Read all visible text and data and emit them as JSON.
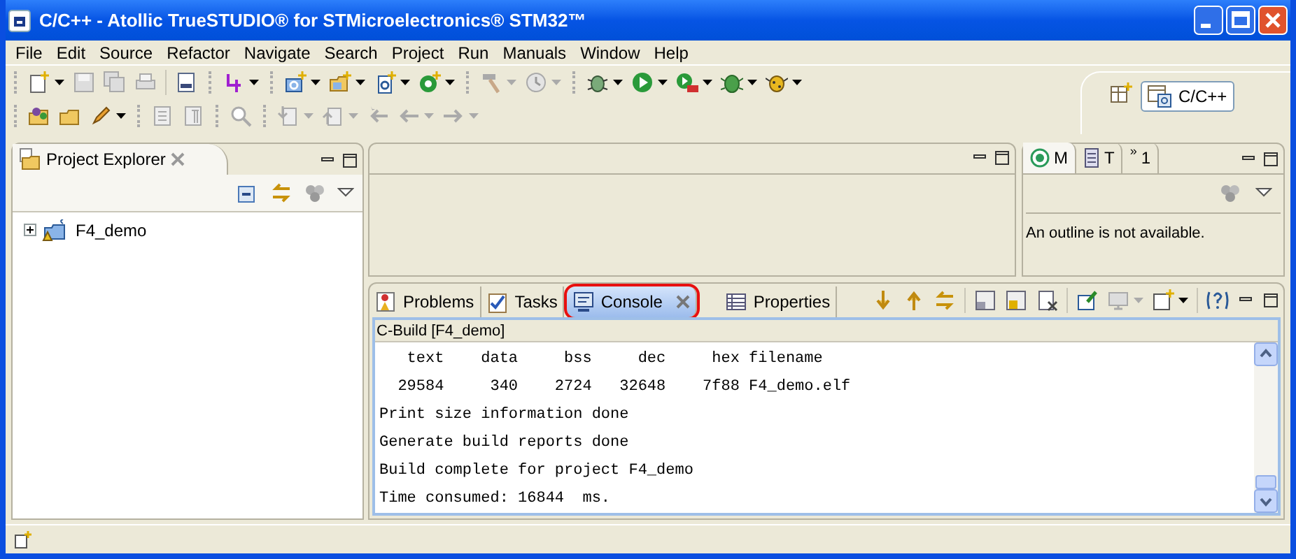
{
  "window": {
    "title": "C/C++ - Atollic TrueSTUDIO® for STMicroelectronics® STM32™"
  },
  "menu": [
    "File",
    "Edit",
    "Source",
    "Refactor",
    "Navigate",
    "Search",
    "Project",
    "Run",
    "Manuals",
    "Window",
    "Help"
  ],
  "perspective": {
    "label": "C/C++",
    "selected": true
  },
  "project_explorer": {
    "tab": {
      "label": "Project Explorer"
    },
    "tree": [
      {
        "label": "F4_demo",
        "expanded": false
      }
    ]
  },
  "outline_panel": {
    "tabs": [
      {
        "label": "M",
        "selected": true
      },
      {
        "label": "T",
        "selected": false
      },
      {
        "label": "$^{»}$1",
        "selected": false
      }
    ],
    "message": "An outline is not available."
  },
  "bottom_panel": {
    "tabs": [
      {
        "label": "Problems",
        "selected": false,
        "highlighted": false
      },
      {
        "label": "Tasks",
        "selected": false,
        "highlighted": false
      },
      {
        "label": "Console",
        "selected": true,
        "highlighted": true
      },
      {
        "label": "Properties",
        "selected": false,
        "highlighted": false
      }
    ],
    "console": {
      "title": "C-Build [F4_demo]",
      "lines": [
        "   text    data     bss     dec     hex filename",
        "  29584     340    2724   32648    7f88 F4_demo.elf",
        "Print size information done",
        "Generate build reports done",
        "Build complete for project F4_demo",
        "Time consumed: 16844  ms."
      ]
    }
  }
}
